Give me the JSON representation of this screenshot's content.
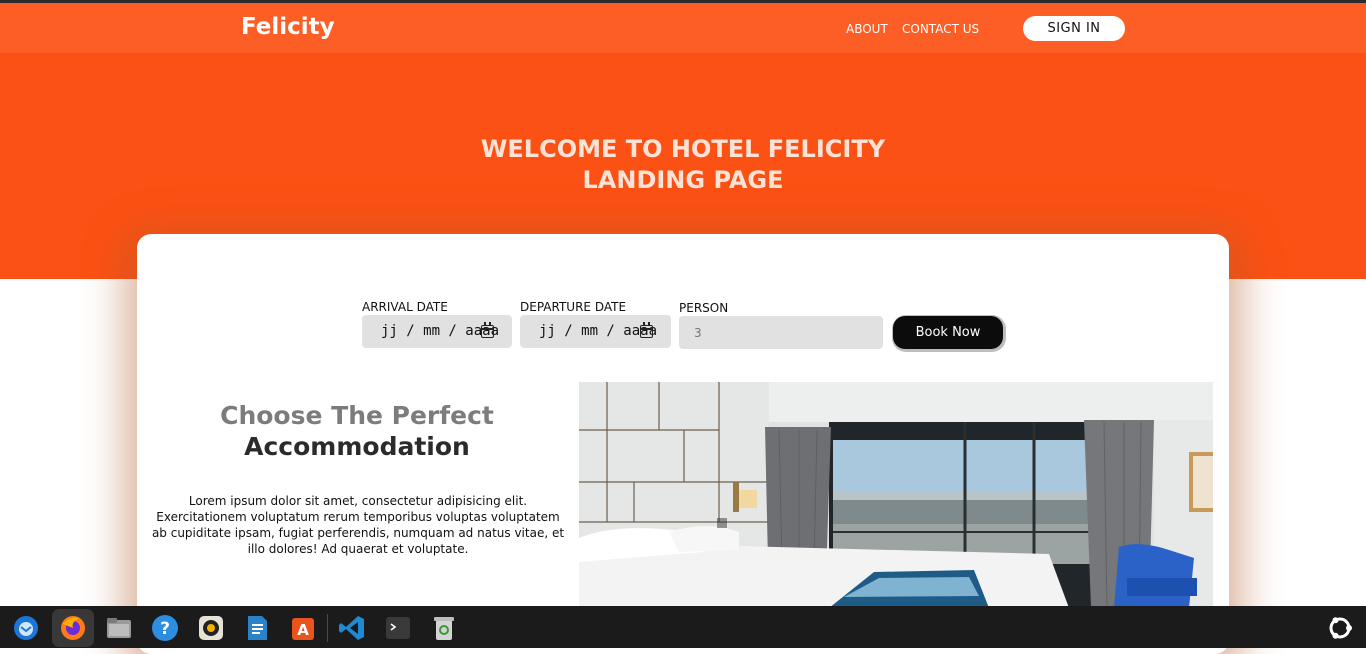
{
  "navbar": {
    "brand": "Felicity",
    "links": [
      "ABOUT",
      "CONTACT US"
    ],
    "signin_label": "SIGN IN"
  },
  "hero": {
    "title_line1": "WELCOME TO HOTEL FELICITY",
    "title_line2": "LANDING PAGE"
  },
  "booking": {
    "arrival_label": "ARRIVAL DATE",
    "arrival_value": "jj / mm / aaaa",
    "departure_label": "DEPARTURE DATE",
    "departure_value": "jj / mm / aaaa",
    "person_label": "PERSON",
    "person_placeholder": "3",
    "book_label": "Book Now"
  },
  "section": {
    "title_line1": "Choose The Perfect",
    "title_line2": "Accommodation",
    "body": "Lorem ipsum dolor sit amet, consectetur adipisicing elit. Exercitationem voluptatum rerum temporibus voluptas voluptatem ab cupiditate ipsam, fugiat perferendis, numquam ad natus vitae, et illo dolores! Ad quaerat et voluptate."
  },
  "colors": {
    "navbar": "#fd5e26",
    "hero": "#fc5114",
    "button_dark": "#0c0c0c"
  },
  "taskbar": {
    "icons": [
      "thunderbird-icon",
      "firefox-icon",
      "files-icon",
      "help-icon",
      "rhythmbox-icon",
      "writer-icon",
      "app-center-icon",
      "vscode-icon",
      "terminal-icon",
      "trash-icon",
      "ubuntu-icon"
    ]
  }
}
